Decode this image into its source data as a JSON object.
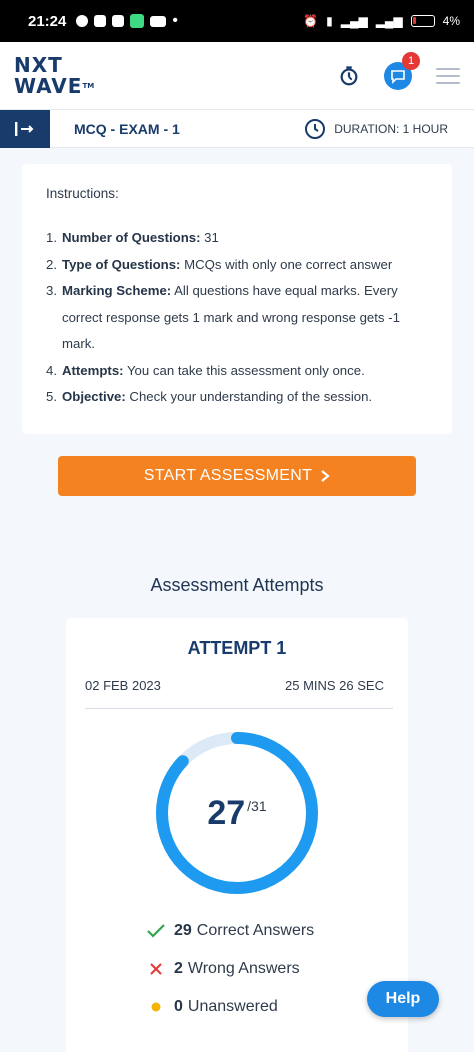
{
  "status_bar": {
    "time": "21:24",
    "battery": "4%"
  },
  "header": {
    "logo_line1": "NXT",
    "logo_line2": "WAVE",
    "logo_tm": "TM",
    "notification_count": "1"
  },
  "exam": {
    "title": "MCQ - EXAM - 1",
    "duration": "DURATION: 1 HOUR"
  },
  "instructions": {
    "heading": "Instructions:",
    "items": [
      {
        "num": "1.",
        "label": "Number of Questions:",
        "text": " 31"
      },
      {
        "num": "2.",
        "label": "Type of Questions:",
        "text": " MCQs with only one correct answer"
      },
      {
        "num": "3.",
        "label": "Marking Scheme:",
        "text": " All questions have equal marks. Every correct response gets 1 mark and wrong response gets -1 mark."
      },
      {
        "num": "4.",
        "label": "Attempts:",
        "text": " You can take this assessment only once."
      },
      {
        "num": "5.",
        "label": "Objective:",
        "text": " Check your understanding of the session."
      }
    ]
  },
  "start_button": "START ASSESSMENT",
  "attempts": {
    "heading": "Assessment Attempts",
    "attempt": {
      "title": "ATTEMPT 1",
      "date": "02 FEB 2023",
      "duration": "25 MINS 26 SEC",
      "score": "27",
      "total": "/31",
      "score_fraction": 0.871,
      "correct_count": "29",
      "correct_label": "Correct Answers",
      "wrong_count": "2",
      "wrong_label": "Wrong Answers",
      "unanswered_count": "0",
      "unanswered_label": "Unanswered"
    }
  },
  "help_button": "Help",
  "colors": {
    "brand": "#183b6b",
    "accent": "#f58220",
    "ring": "#1e9bf0",
    "ring_track": "#dce9f6",
    "correct": "#2ea44f",
    "wrong": "#e53935",
    "unanswered": "#f5b400"
  },
  "icons": [
    "timer-icon",
    "chat-icon",
    "menu-icon",
    "exit-icon",
    "clock-icon",
    "chevron-right-icon",
    "check-icon",
    "cross-icon",
    "dot-icon"
  ]
}
